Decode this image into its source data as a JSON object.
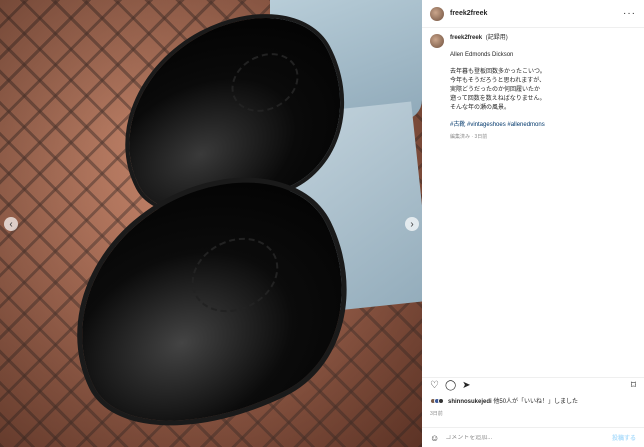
{
  "post": {
    "username": "freek2freek",
    "edited_label": "(記録用)",
    "caption_title": "Allen Edmonds Dickson",
    "caption_lines": [
      "去年暮も登板回数多かったこいつ。",
      "今年もそうだろうと思われますが、",
      "実際どうだったのか何回履いたか",
      "遡って回数を数えねばなりません。",
      "そんな年の瀬の風景。"
    ],
    "hashtags": "#古靴 #vintageshoes #allenedmons",
    "meta": "編集済み · 3日前",
    "likes_user": "shinnosukejedi",
    "likes_rest": "他50人が「いいね！」しました",
    "date": "3日前"
  },
  "comment": {
    "placeholder": "コメントを追加...",
    "post_label": "投稿する"
  },
  "icons": {
    "more": "more-horizontal-icon",
    "heart": "heart-icon",
    "comment": "comment-icon",
    "share": "share-icon",
    "save": "bookmark-icon",
    "emoji": "emoji-icon",
    "prev": "chevron-left-icon",
    "next": "chevron-right-icon"
  }
}
